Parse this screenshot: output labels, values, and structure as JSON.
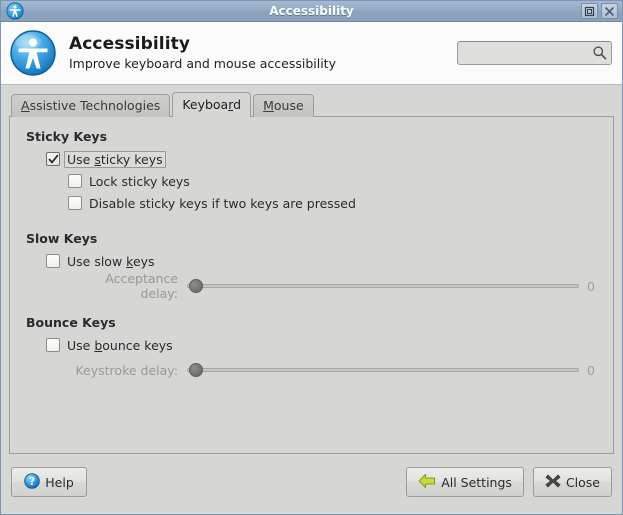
{
  "window": {
    "title": "Accessibility",
    "titlebar_icon": "accessibility-person-icon",
    "maximize_icon": "maximize-icon",
    "close_icon": "window-close-icon"
  },
  "header": {
    "icon": "accessibility-person-icon",
    "title": "Accessibility",
    "subtitle": "Improve keyboard and mouse accessibility",
    "search": {
      "value": "",
      "placeholder": "",
      "icon": "search-icon"
    }
  },
  "tabs": [
    {
      "label": "Assistive Technologies",
      "mnemonic_pre": "",
      "mnemonic": "A",
      "mnemonic_post": "ssistive Technologies",
      "active": false
    },
    {
      "label": "Keyboard",
      "mnemonic_pre": "Keyboa",
      "mnemonic": "r",
      "mnemonic_post": "d",
      "active": true
    },
    {
      "label": "Mouse",
      "mnemonic_pre": "",
      "mnemonic": "M",
      "mnemonic_post": "ouse",
      "active": false
    }
  ],
  "groups": {
    "sticky": {
      "title": "Sticky Keys",
      "use": {
        "label_pre": "Use ",
        "label_mnemonic": "s",
        "label_post": "ticky keys",
        "checked": true,
        "focused": true
      },
      "lock": {
        "label": "Lock sticky keys",
        "checked": false
      },
      "disable": {
        "label": "Disable sticky keys if two keys are pressed",
        "checked": false
      }
    },
    "slow": {
      "title": "Slow Keys",
      "use": {
        "label_pre": "Use slow ",
        "label_mnemonic": "k",
        "label_post": "eys",
        "checked": false
      },
      "delay": {
        "label": "Acceptance delay:",
        "value": "0",
        "enabled": false
      }
    },
    "bounce": {
      "title": "Bounce Keys",
      "use": {
        "label_pre": "Use ",
        "label_mnemonic": "b",
        "label_post": "ounce keys",
        "checked": false
      },
      "delay": {
        "label": "Keystroke delay:",
        "value": "0",
        "enabled": false
      }
    }
  },
  "actions": {
    "help": {
      "label": "Help",
      "icon": "help-question-icon"
    },
    "all_settings": {
      "label": "All Settings",
      "icon": "back-arrow-icon"
    },
    "close": {
      "label": "Close",
      "icon": "close-x-icon"
    }
  },
  "colors": {
    "titlebar": "#8ca4bf",
    "panel": "#d6d6d4",
    "header_band": "#fbfbfb",
    "accent_icon_blue": "#2f9ae0",
    "arrow_green": "#c6d93a"
  }
}
